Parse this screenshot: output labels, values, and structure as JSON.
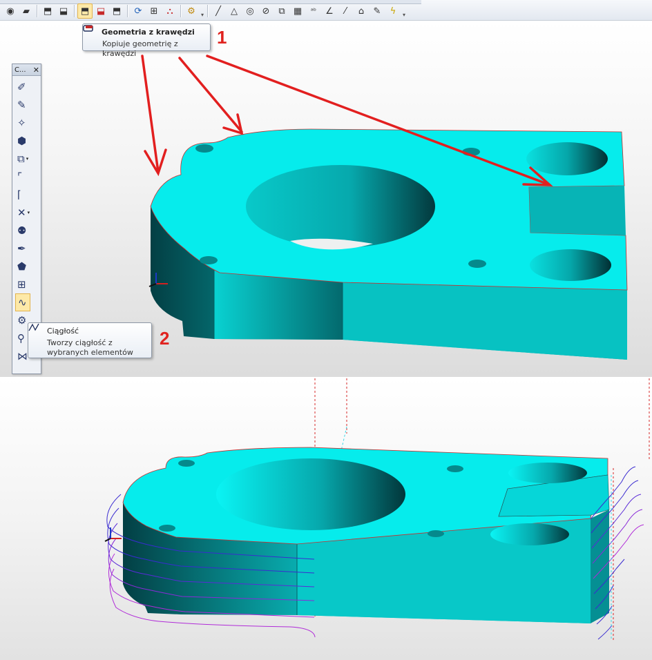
{
  "toolbar": {
    "groups": [
      [
        "eye-icon",
        "eraser-icon"
      ],
      [
        "copy-geometry-icon",
        "edit-geometry-icon"
      ],
      [
        "geometry-from-edges-icon",
        "geometry-red-icon",
        "geometry-gray-icon"
      ],
      [
        "refresh-icon",
        "workplane-icon",
        "pdf-icon"
      ],
      [
        "settings-gear-icon"
      ],
      [
        "line-icon",
        "triangle-icon",
        "circle-icon",
        "no-entry-icon",
        "transform-icon",
        "hatch-icon",
        "text-abc-icon",
        "dimension-angle-icon",
        "slash-icon",
        "house-plus-icon",
        "pencil-icon",
        "lightning-icon"
      ]
    ],
    "glyphs": {
      "eye-icon": "◉",
      "eraser-icon": "▰",
      "copy-geometry-icon": "⬒",
      "edit-geometry-icon": "⬓",
      "geometry-from-edges-icon": "⬒",
      "geometry-red-icon": "⬓",
      "geometry-gray-icon": "⬒",
      "refresh-icon": "⟳",
      "workplane-icon": "⊞",
      "pdf-icon": "⛬",
      "settings-gear-icon": "⚙",
      "line-icon": "╱",
      "triangle-icon": "△",
      "circle-icon": "◎",
      "no-entry-icon": "⊘",
      "transform-icon": "⧉",
      "hatch-icon": "▦",
      "text-abc-icon": "ᵃᵇ",
      "dimension-angle-icon": "∠",
      "slash-icon": "⁄",
      "house-plus-icon": "⌂",
      "pencil-icon": "✎",
      "lightning-icon": "ϟ"
    }
  },
  "tooltip_geometry": {
    "title": "Geometria z krawędzi",
    "description": "Kopiuje geometrię z krawędzi"
  },
  "tooltip_continuity": {
    "title": "Ciągłość",
    "description": "Tworzy ciągłość z wybranych elementów"
  },
  "markers": {
    "one": "1",
    "two": "2"
  },
  "palette": {
    "title": "C...",
    "close": "✕",
    "tools": [
      {
        "name": "brush-icon",
        "glyph": "✐"
      },
      {
        "name": "dimension-pencil-icon",
        "glyph": "✎"
      },
      {
        "name": "star-line-icon",
        "glyph": "✧"
      },
      {
        "name": "yellow-block-icon",
        "glyph": "⬢"
      },
      {
        "name": "shapes-dropdown-icon",
        "glyph": "⧉",
        "dropdown": "▾"
      },
      {
        "name": "fillet-icon",
        "glyph": "⌜"
      },
      {
        "name": "chamfer-icon",
        "glyph": "⌈"
      },
      {
        "name": "intersect-dropdown-icon",
        "glyph": "✕",
        "dropdown": "▾"
      },
      {
        "name": "robot-icon",
        "glyph": "⚉"
      },
      {
        "name": "syringe-icon",
        "glyph": "✒"
      },
      {
        "name": "solid-icon",
        "glyph": "⬟"
      },
      {
        "name": "grid-icon",
        "glyph": "⊞"
      },
      {
        "name": "continuity-icon",
        "glyph": "∿"
      },
      {
        "name": "gear-pattern-icon",
        "glyph": "⚙"
      },
      {
        "name": "link-icon",
        "glyph": "⚲"
      },
      {
        "name": "axis-icon",
        "glyph": "⋈"
      }
    ]
  },
  "colors": {
    "part_top": "#06eaea",
    "part_side": "#07c6c6",
    "part_dark": "#035e62",
    "arrow": "#e21f1f",
    "curve_blue": "#3a2bd0",
    "curve_magenta": "#b02ad8",
    "dashed_red": "#d62828",
    "dashed_cyan": "#3ad9e8"
  }
}
